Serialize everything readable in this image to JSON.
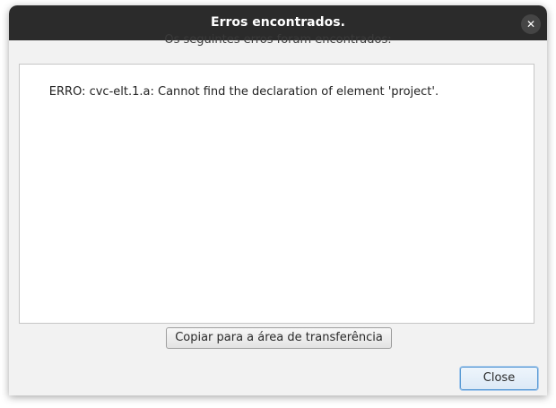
{
  "window": {
    "title": "Erros encontrados.",
    "close_glyph": "✕"
  },
  "content": {
    "heading": "Os seguintes erros foram encontrados:",
    "error_text": "ERRO: cvc-elt.1.a: Cannot find the declaration of element 'project'."
  },
  "buttons": {
    "copy_label": "Copiar para a área de transferência",
    "close_label": "Close"
  },
  "colors": {
    "titlebar": "#2b2b2b",
    "dialog_bg": "#f2f2f2",
    "default_button_border": "#5b9bd5"
  }
}
